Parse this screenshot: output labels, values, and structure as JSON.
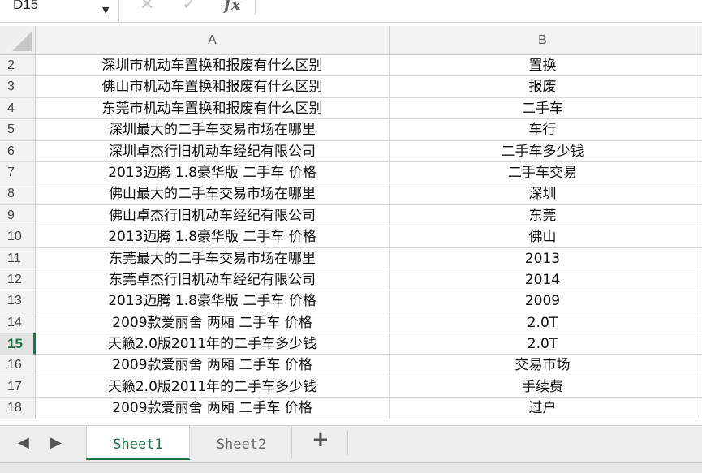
{
  "formula_bar": {
    "cell_ref": "D15",
    "cancel_icon": "✕",
    "confirm_icon": "✓",
    "fx_label": "fx"
  },
  "columns": [
    "A",
    "B"
  ],
  "rows": [
    {
      "num": "2",
      "a": "深圳市机动车置换和报废有什么区别",
      "b": "置换"
    },
    {
      "num": "3",
      "a": "佛山市机动车置换和报废有什么区别",
      "b": "报废"
    },
    {
      "num": "4",
      "a": "东莞市机动车置换和报废有什么区别",
      "b": "二手车"
    },
    {
      "num": "5",
      "a": "深圳最大的二手车交易市场在哪里",
      "b": "车行"
    },
    {
      "num": "6",
      "a": "深圳卓杰行旧机动车经纪有限公司",
      "b": "二手车多少钱"
    },
    {
      "num": "7",
      "a": "2013迈腾 1.8豪华版 二手车 价格",
      "b": "二手车交易"
    },
    {
      "num": "8",
      "a": "佛山最大的二手车交易市场在哪里",
      "b": "深圳"
    },
    {
      "num": "9",
      "a": "佛山卓杰行旧机动车经纪有限公司",
      "b": "东莞"
    },
    {
      "num": "10",
      "a": "2013迈腾 1.8豪华版 二手车 价格",
      "b": "佛山"
    },
    {
      "num": "11",
      "a": "东莞最大的二手车交易市场在哪里",
      "b": "2013"
    },
    {
      "num": "12",
      "a": "东莞卓杰行旧机动车经纪有限公司",
      "b": "2014"
    },
    {
      "num": "13",
      "a": "2013迈腾 1.8豪华版 二手车 价格",
      "b": "2009"
    },
    {
      "num": "14",
      "a": "2009款爱丽舍 两厢 二手车 价格",
      "b": "2.0T"
    },
    {
      "num": "15",
      "a": "天籁2.0版2011年的二手车多少钱",
      "b": "2.0T"
    },
    {
      "num": "16",
      "a": "2009款爱丽舍 两厢 二手车 价格",
      "b": "交易市场"
    },
    {
      "num": "17",
      "a": "天籁2.0版2011年的二手车多少钱",
      "b": "手续费"
    },
    {
      "num": "18",
      "a": "2009款爱丽舍 两厢 二手车 价格",
      "b": "过户"
    }
  ],
  "active_row": "15",
  "tabs": {
    "prev_icon": "◀",
    "next_icon": "▶",
    "sheet1": "Sheet1",
    "sheet2": "Sheet2",
    "add_icon": "+"
  },
  "colors": {
    "accent": "#217346"
  }
}
